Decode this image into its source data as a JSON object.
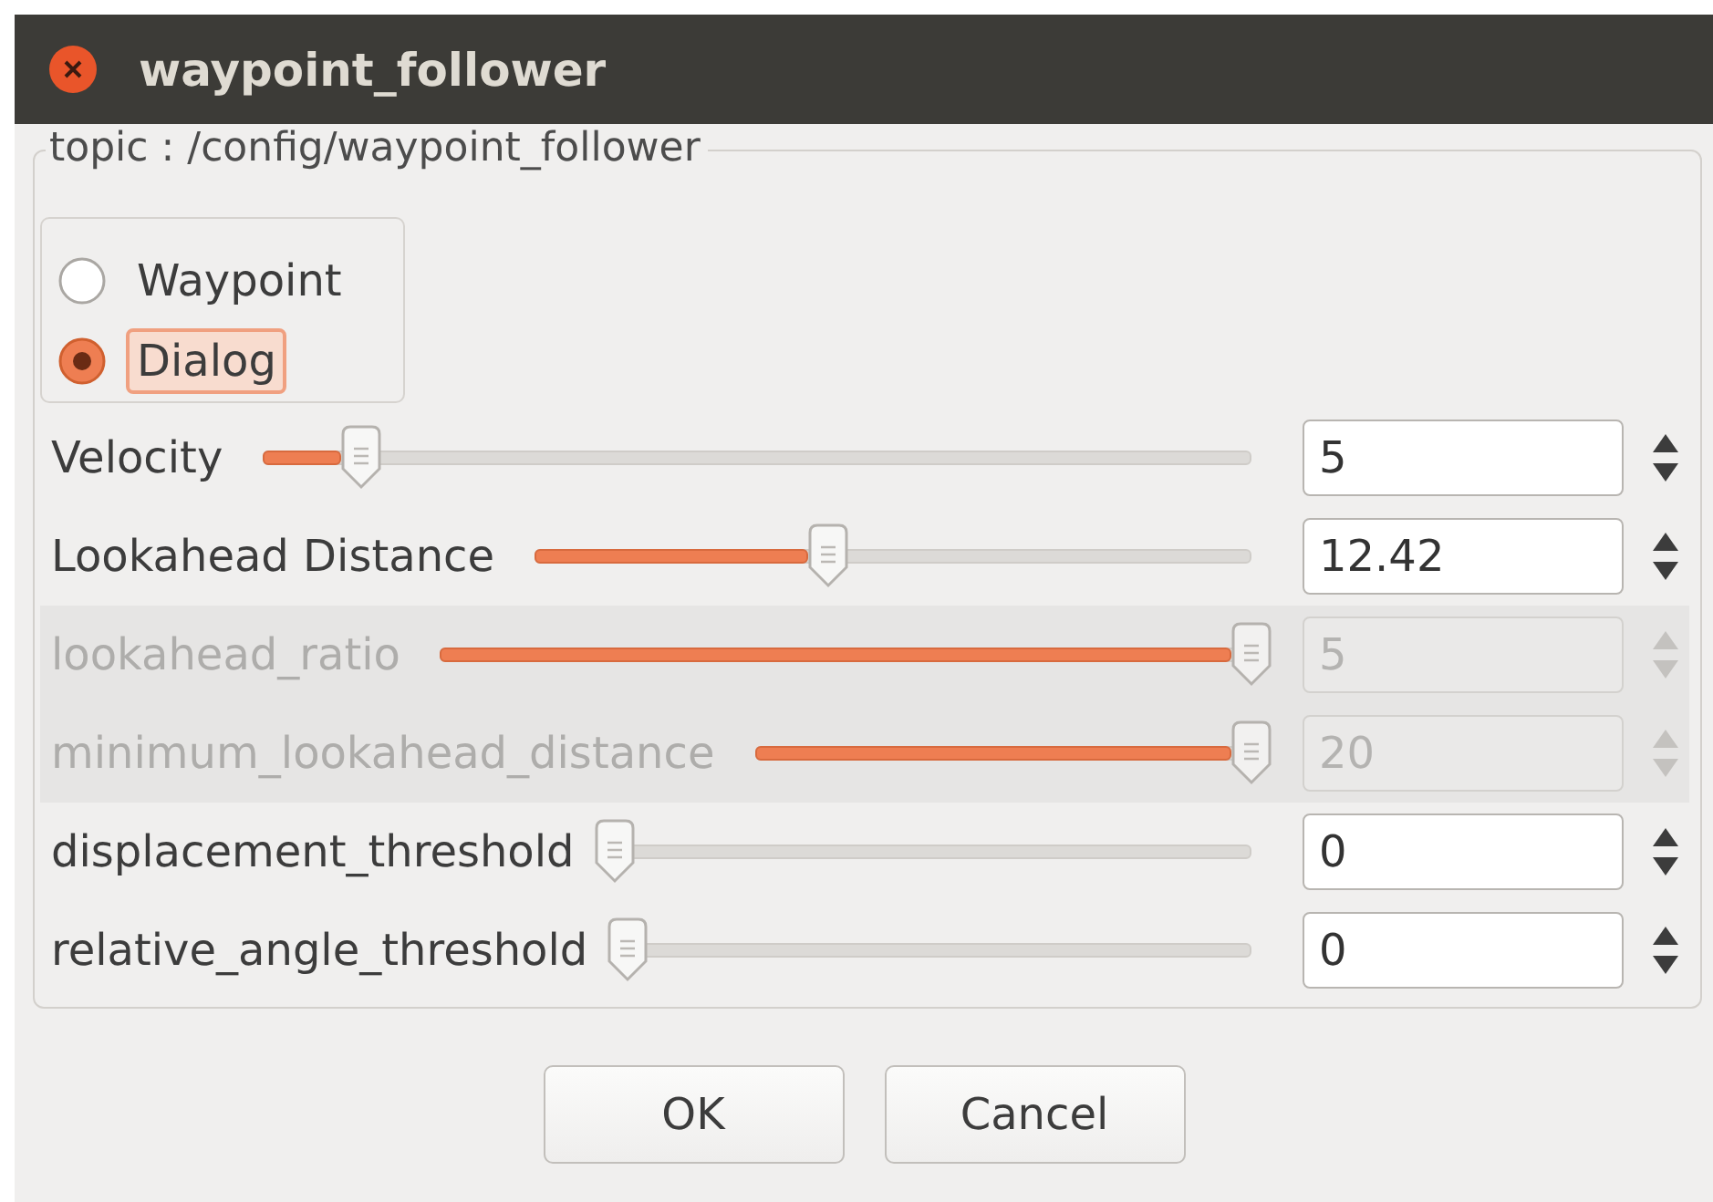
{
  "window": {
    "title": "waypoint_follower"
  },
  "group": {
    "title": "topic : /config/waypoint_follower"
  },
  "mode_options": [
    {
      "label": "Waypoint",
      "selected": false,
      "focused": false
    },
    {
      "label": "Dialog",
      "selected": true,
      "focused": true
    }
  ],
  "params": [
    {
      "label": "Velocity",
      "level": 0.1,
      "value": "5",
      "disabled": false
    },
    {
      "label": "Lookahead Distance",
      "level": 0.41,
      "value": "12.42",
      "disabled": false
    },
    {
      "label": "lookahead_ratio",
      "level": 1,
      "value": "5",
      "disabled": true
    },
    {
      "label": "minimum_lookahead_distance",
      "level": 1,
      "value": "20",
      "disabled": true
    },
    {
      "label": "displacement_threshold",
      "level": 0,
      "value": "0",
      "disabled": false
    },
    {
      "label": "relative_angle_threshold",
      "level": 0,
      "value": "0",
      "disabled": false
    }
  ],
  "buttons": [
    "OK",
    "Cancel"
  ]
}
